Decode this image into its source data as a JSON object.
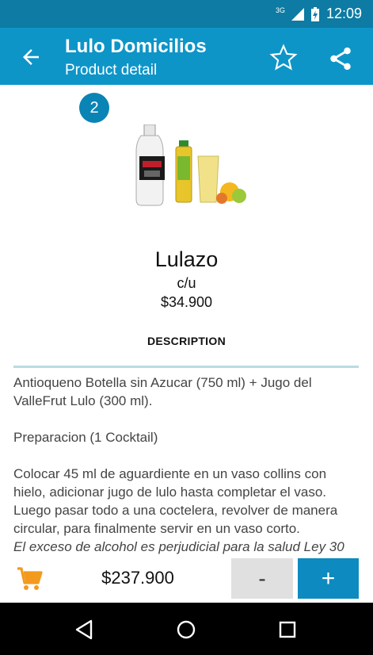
{
  "status_bar": {
    "network": "3G",
    "time": "12:09"
  },
  "app_bar": {
    "title": "Lulo Domicilios",
    "subtitle": "Product detail"
  },
  "product": {
    "badge_count": "2",
    "name": "Lulazo",
    "unit": "c/u",
    "price": "$34.900",
    "description_heading": "DESCRIPTION",
    "description": {
      "para1": "Antioqueno Botella sin Azucar (750 ml) + Jugo del ValleFrut Lulo (300 ml).",
      "para2": "Preparacion (1 Cocktail)",
      "para3": "Colocar 45 ml de aguardiente en un vaso collins con hielo, adicionar jugo de lulo hasta completar el vaso. Luego pasar todo a una coctelera, revolver de manera circular, para finalmente servir en un vaso corto.",
      "warning": "El exceso de alcohol es perjudicial para la salud Ley 30"
    }
  },
  "bottom_bar": {
    "total": "$237.900",
    "minus_label": "-",
    "plus_label": "+"
  },
  "colors": {
    "status_bar": "#0d7ba3",
    "app_bar": "#0e95c8",
    "accent": "#0d8bc0",
    "cart": "#f39a1e"
  },
  "icons": [
    "back-arrow-icon",
    "star-outline-icon",
    "share-icon",
    "cart-icon",
    "nav-back-icon",
    "nav-home-icon",
    "nav-recents-icon"
  ]
}
